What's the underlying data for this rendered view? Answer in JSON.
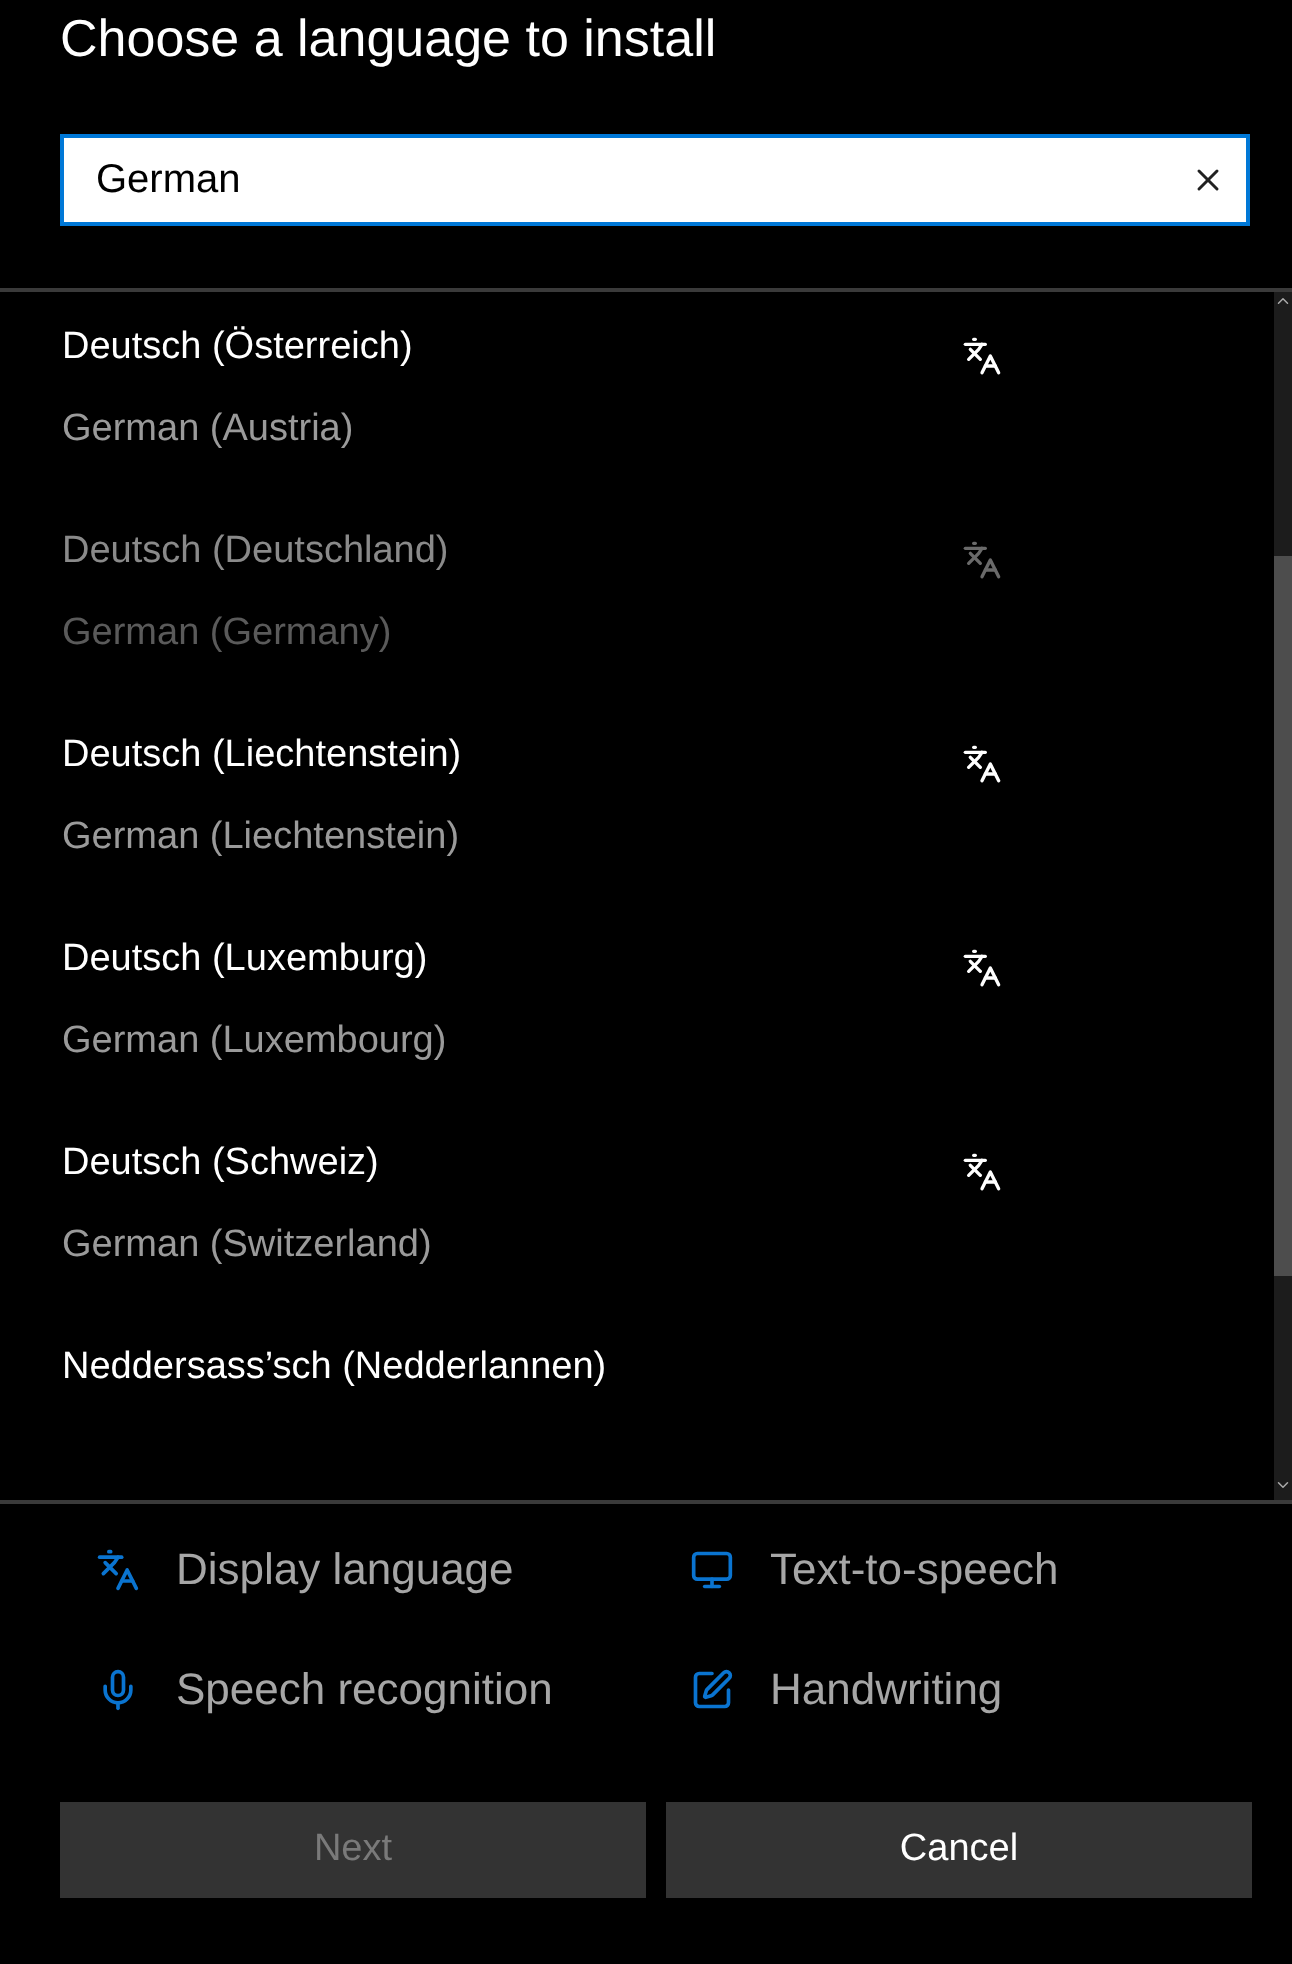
{
  "title": "Choose a language to install",
  "search": {
    "value": "German"
  },
  "languages": [
    {
      "name": "Deutsch (Österreich)",
      "subtitle": "German (Austria)",
      "disabled": false
    },
    {
      "name": "Deutsch (Deutschland)",
      "subtitle": "German (Germany)",
      "disabled": true
    },
    {
      "name": "Deutsch (Liechtenstein)",
      "subtitle": "German (Liechtenstein)",
      "disabled": false
    },
    {
      "name": "Deutsch (Luxemburg)",
      "subtitle": "German (Luxembourg)",
      "disabled": false
    },
    {
      "name": "Deutsch (Schweiz)",
      "subtitle": "German (Switzerland)",
      "disabled": false
    },
    {
      "name": "Neddersass’sch (Nedderlannen)",
      "disabled": false
    }
  ],
  "features": [
    {
      "kind": "display",
      "label": "Display language"
    },
    {
      "kind": "tts",
      "label": "Text-to-speech"
    },
    {
      "kind": "speech",
      "label": "Speech recognition"
    },
    {
      "kind": "handwriting",
      "label": "Handwriting"
    }
  ],
  "buttons": [
    {
      "label": "Next",
      "disabled": true
    },
    {
      "label": "Cancel",
      "disabled": false
    }
  ]
}
